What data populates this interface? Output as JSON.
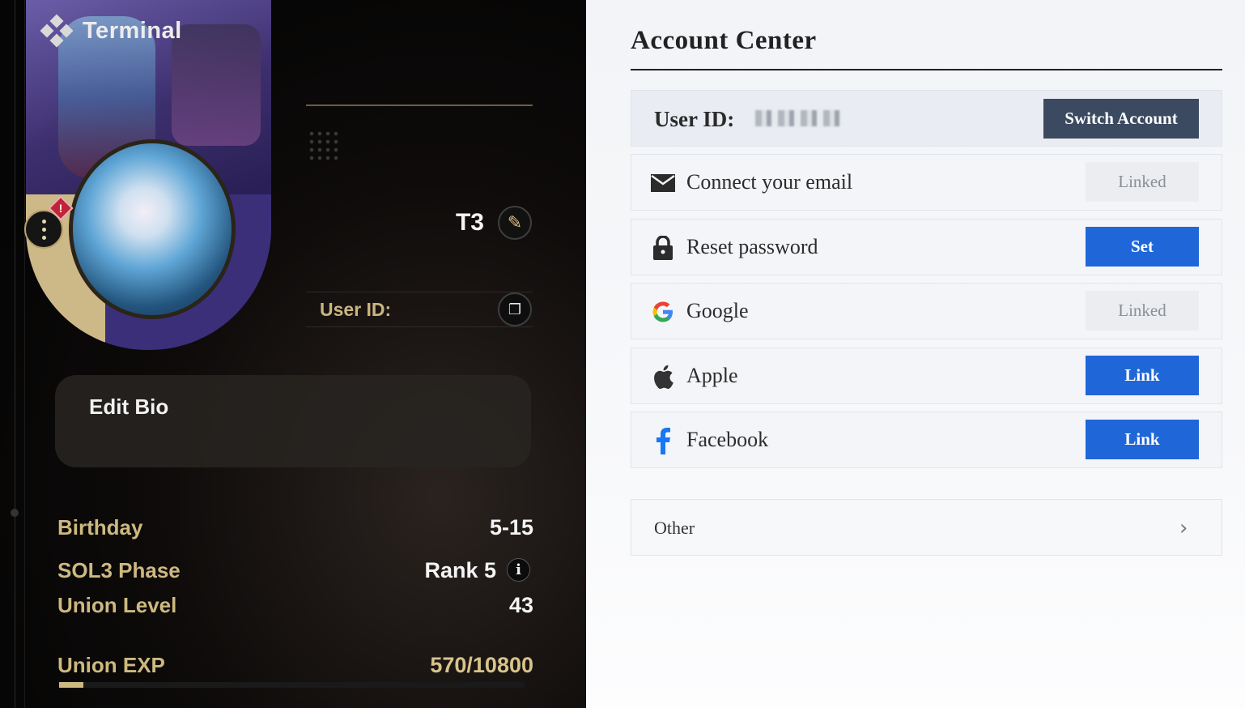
{
  "game": {
    "terminal_title": "Terminal",
    "nickname": "T3",
    "user_id_label": "User ID:",
    "bio_placeholder": "Edit Bio",
    "alert_glyph": "!",
    "info_glyph": "i",
    "stats": [
      {
        "label": "Birthday",
        "value": "5-15"
      },
      {
        "label": "SOL3 Phase",
        "value": "Rank 5"
      },
      {
        "label": "Union Level",
        "value": "43"
      },
      {
        "label": "Union EXP",
        "value": "570/10800"
      }
    ],
    "exp_progress": 0.053,
    "icons": [
      "diamond-menu-icon",
      "more-dots-icon",
      "alert-icon",
      "edit-pencil-icon",
      "copy-icon",
      "info-icon"
    ],
    "accent": "#cdb980"
  },
  "account": {
    "title": "Account Center",
    "user_id_label": "User ID:",
    "switch_label": "Switch Account",
    "rows": [
      {
        "label": "Connect your email",
        "icon": "envelope-icon",
        "button": "Linked",
        "state": "linked"
      },
      {
        "label": "Reset password",
        "icon": "lock-icon",
        "button": "Set",
        "state": "action"
      },
      {
        "label": "Google",
        "icon": "google-icon",
        "button": "Linked",
        "state": "linked"
      },
      {
        "label": "Apple",
        "icon": "apple-icon",
        "button": "Link",
        "state": "action"
      },
      {
        "label": "Facebook",
        "icon": "facebook-icon",
        "button": "Link",
        "state": "action"
      }
    ],
    "other_label": "Other",
    "chevron": "›",
    "accent": "#1f67d8",
    "switch_color": "#3b4a60"
  }
}
